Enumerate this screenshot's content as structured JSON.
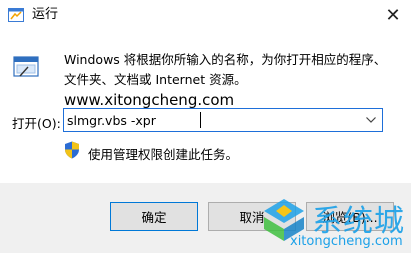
{
  "window": {
    "title": "运行",
    "close_symbol": "✕"
  },
  "dialog": {
    "description_line1": "Windows 将根据你所输入的名称，为你打开相应的程序、",
    "description_line2_prefix": "文件夹、文档或 Internet 资源。",
    "description_line2_url": "www.xitongcheng.com",
    "open_label": "打开(O):",
    "open_value": "slmgr.vbs -xpr",
    "admin_note": "使用管理权限创建此任务。"
  },
  "buttons": {
    "ok": "确定",
    "cancel": "取消",
    "browse": "浏览(B)..."
  },
  "watermark": {
    "text": "系统城",
    "url": "xitongcheng.com"
  },
  "colors": {
    "accent": "#0078d7",
    "watermark": "#1da1e8"
  }
}
